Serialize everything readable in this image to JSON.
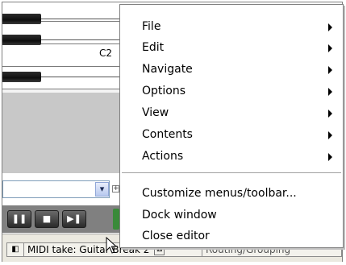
{
  "piano_roll": {
    "note_label": "C2"
  },
  "tabs": {
    "midi_tab_label": "MIDI take: Guitar Break 2",
    "close_glyph": "⊠",
    "routing_tab_label": "Routing/Grouping"
  },
  "combo": {
    "arrow_glyph": "▾"
  },
  "plus_glyph": "+",
  "transport": [
    {
      "name": "pause-button",
      "glyph": "❚❚"
    },
    {
      "name": "stop-button",
      "glyph": "■"
    },
    {
      "name": "next-button",
      "glyph": "▶❚"
    }
  ],
  "context_menu": {
    "items": [
      {
        "label": "File",
        "submenu": true
      },
      {
        "label": "Edit",
        "submenu": true
      },
      {
        "label": "Navigate",
        "submenu": true
      },
      {
        "label": "Options",
        "submenu": true
      },
      {
        "label": "View",
        "submenu": true
      },
      {
        "label": "Contents",
        "submenu": true
      },
      {
        "label": "Actions",
        "submenu": true
      },
      {
        "label": "Customize menus/toolbar...",
        "submenu": false
      },
      {
        "label": "Dock window",
        "submenu": false
      },
      {
        "label": "Close editor",
        "submenu": false
      }
    ]
  },
  "colors": {
    "menu_bg": "#ffffff",
    "menu_border": "#808080",
    "transport_bg": "#808080"
  }
}
